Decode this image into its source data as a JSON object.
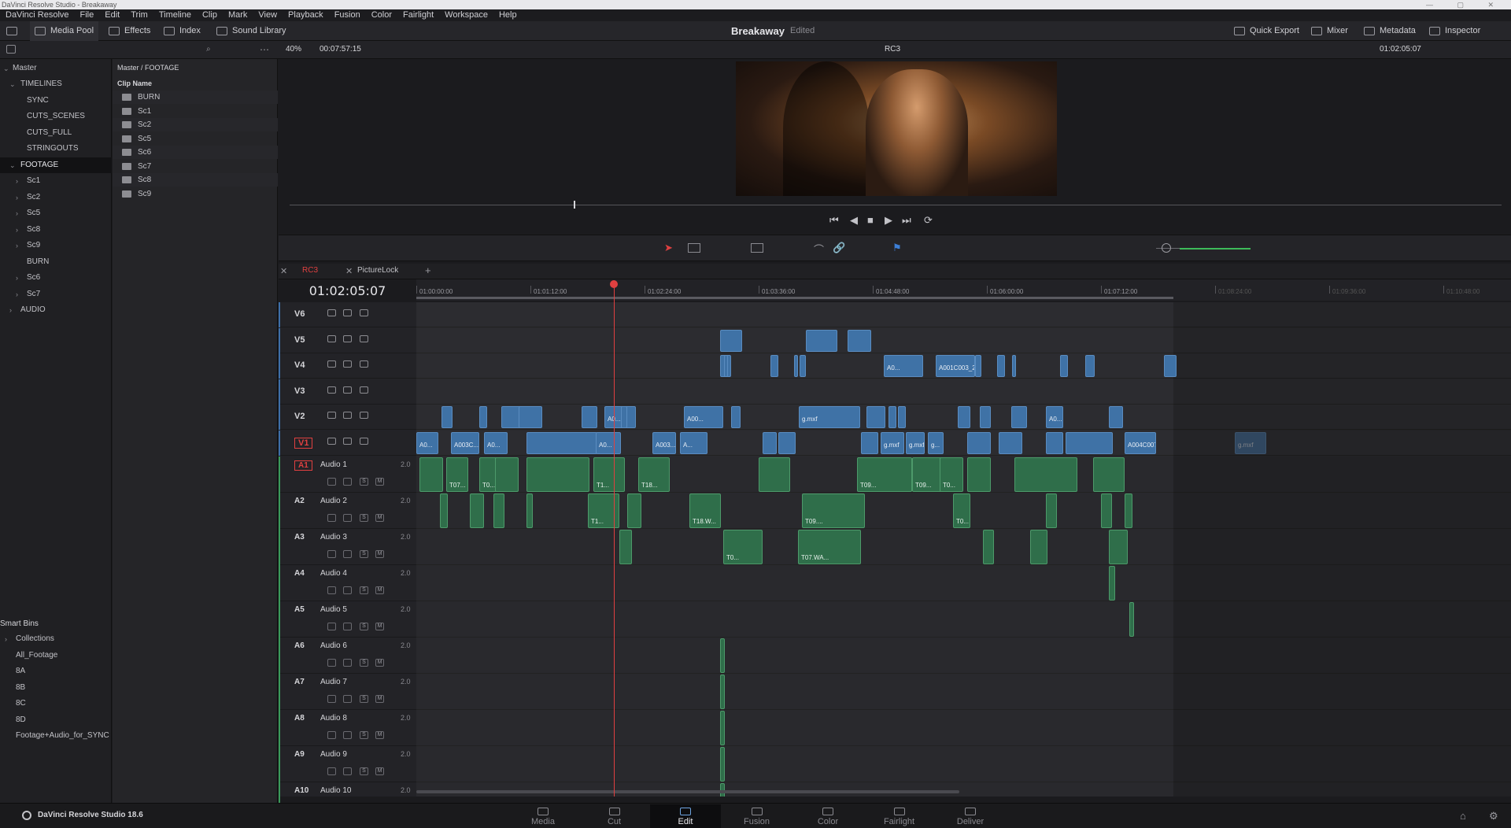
{
  "window": {
    "title": "DaVinci Resolve Studio - Breakaway"
  },
  "menu": [
    "DaVinci Resolve",
    "File",
    "Edit",
    "Trim",
    "Timeline",
    "Clip",
    "Mark",
    "View",
    "Playback",
    "Fusion",
    "Color",
    "Fairlight",
    "Workspace",
    "Help"
  ],
  "toolbar": {
    "media_pool": "Media Pool",
    "effects": "Effects",
    "index": "Index",
    "sound_library": "Sound Library",
    "project_title": "Breakaway",
    "project_status": "Edited",
    "quick_export": "Quick Export",
    "mixer": "Mixer",
    "metadata": "Metadata",
    "inspector": "Inspector"
  },
  "viewer": {
    "zoom": "40%",
    "duration": "00:07:57:15",
    "timeline_name": "RC3",
    "timecode": "01:02:05:07"
  },
  "bins": {
    "master": "Master",
    "items": [
      {
        "label": "TIMELINES",
        "level": 1,
        "expanded": true
      },
      {
        "label": "SYNC",
        "level": 2
      },
      {
        "label": "CUTS_SCENES",
        "level": 2
      },
      {
        "label": "CUTS_FULL",
        "level": 2
      },
      {
        "label": "STRINGOUTS",
        "level": 2
      },
      {
        "label": "FOOTAGE",
        "level": 1,
        "expanded": true,
        "selected": true
      },
      {
        "label": "Sc1",
        "level": 2,
        "chev": true
      },
      {
        "label": "Sc2",
        "level": 2,
        "chev": true
      },
      {
        "label": "Sc5",
        "level": 2,
        "chev": true
      },
      {
        "label": "Sc8",
        "level": 2,
        "chev": true
      },
      {
        "label": "Sc9",
        "level": 2,
        "chev": true
      },
      {
        "label": "BURN",
        "level": 2
      },
      {
        "label": "Sc6",
        "level": 2,
        "chev": true
      },
      {
        "label": "Sc7",
        "level": 2,
        "chev": true
      },
      {
        "label": "AUDIO",
        "level": 1,
        "chev": true
      }
    ],
    "smart_bins_title": "Smart Bins",
    "smart_bins": [
      "Collections",
      "All_Footage",
      "8A",
      "8B",
      "8C",
      "8D",
      "Footage+Audio_for_SYNC"
    ]
  },
  "clip_panel": {
    "path": "Master / FOOTAGE",
    "column": "Clip Name",
    "clips": [
      "BURN",
      "Sc1",
      "Sc2",
      "Sc5",
      "Sc6",
      "Sc7",
      "Sc8",
      "Sc9"
    ]
  },
  "timeline": {
    "tabs": [
      "RC3",
      "PictureLock"
    ],
    "timecode": "01:02:05:07",
    "ruler": [
      "01:00:00:00",
      "01:01:12:00",
      "01:02:24:00",
      "01:03:36:00",
      "01:04:48:00",
      "01:06:00:00",
      "01:07:12:00",
      "01:08:24:00",
      "01:09:36:00",
      "01:10:48:00"
    ],
    "video_tracks": [
      "V6",
      "V5",
      "V4",
      "V3",
      "V2",
      "V1"
    ],
    "audio_tracks": [
      {
        "id": "A1",
        "name": "Audio 1",
        "ch": "2.0"
      },
      {
        "id": "A2",
        "name": "Audio 2",
        "ch": "2.0"
      },
      {
        "id": "A3",
        "name": "Audio 3",
        "ch": "2.0"
      },
      {
        "id": "A4",
        "name": "Audio 4",
        "ch": "2.0"
      },
      {
        "id": "A5",
        "name": "Audio 5",
        "ch": "2.0"
      },
      {
        "id": "A6",
        "name": "Audio 6",
        "ch": "2.0"
      },
      {
        "id": "A7",
        "name": "Audio 7",
        "ch": "2.0"
      },
      {
        "id": "A8",
        "name": "Audio 8",
        "ch": "2.0"
      },
      {
        "id": "A9",
        "name": "Audio 9",
        "ch": "2.0"
      },
      {
        "id": "A10",
        "name": "Audio 10",
        "ch": "2.0"
      }
    ],
    "video_clip_labels": [
      "A0...",
      "A001C003_2...",
      "A00...",
      "g.mxf",
      "A0...",
      "A003C...",
      "A0...",
      "A0...",
      "A003...",
      "A...",
      "g.mxf",
      "g.mxf",
      "g...",
      "A004C007_21...",
      "g.mxf",
      "A0..."
    ],
    "audio_clip_labels": [
      "T07...",
      "T0...",
      "T1...",
      "T18...",
      "T09...",
      "T09...",
      "T0...",
      "T1...",
      "T18.W...",
      "T09....",
      "T0...",
      "T0...",
      "T07.WA..."
    ]
  },
  "pages": [
    "Media",
    "Cut",
    "Edit",
    "Fusion",
    "Color",
    "Fairlight",
    "Deliver"
  ],
  "active_page": "Edit",
  "app_name": "DaVinci Resolve Studio 18.6",
  "colors": {
    "accent": "#e04040",
    "video_clip": "#3f72a6",
    "audio_clip": "#2f6e4a"
  }
}
